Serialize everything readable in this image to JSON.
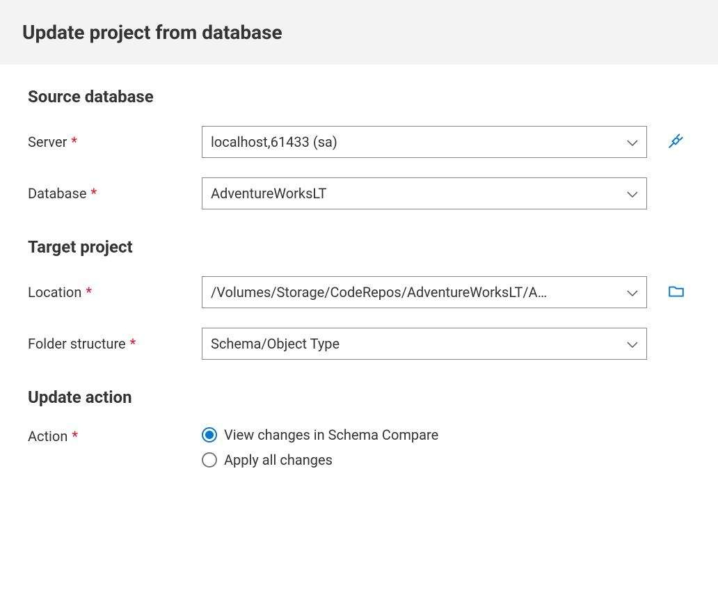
{
  "header": {
    "title": "Update project from database"
  },
  "sections": {
    "source": {
      "title": "Source database",
      "server": {
        "label": "Server",
        "value": "localhost,61433 (sa)"
      },
      "database": {
        "label": "Database",
        "value": "AdventureWorksLT"
      }
    },
    "target": {
      "title": "Target project",
      "location": {
        "label": "Location",
        "value": "/Volumes/Storage/CodeRepos/AdventureWorksLT/A…"
      },
      "folder_structure": {
        "label": "Folder structure",
        "value": "Schema/Object Type"
      }
    },
    "action": {
      "title": "Update action",
      "label": "Action",
      "options": {
        "view": "View changes in Schema Compare",
        "apply": "Apply all changes"
      },
      "selected": "view"
    }
  },
  "required_marker": "*"
}
